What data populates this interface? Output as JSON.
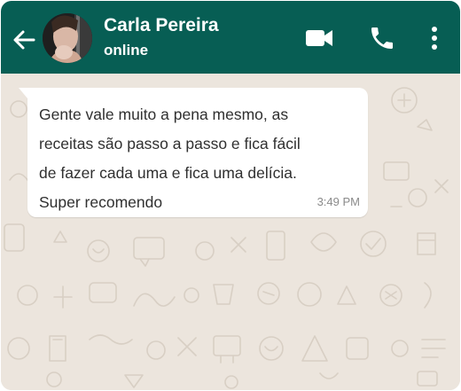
{
  "header": {
    "contact_name": "Carla Pereira",
    "status": "online",
    "background_color": "#075e54",
    "icons": {
      "back": "arrow-left-icon",
      "video": "video-camera-icon",
      "call": "phone-icon",
      "menu": "more-vertical-icon"
    }
  },
  "chat": {
    "background_color": "#ece5dd",
    "messages": [
      {
        "direction": "incoming",
        "lines": [
          "Gente vale muito a pena mesmo, as",
          "receitas são passo a passo e fica fácil",
          "de fazer cada uma e fica uma delícia.",
          "Super recomendo"
        ],
        "time": "3:49 PM"
      }
    ]
  }
}
